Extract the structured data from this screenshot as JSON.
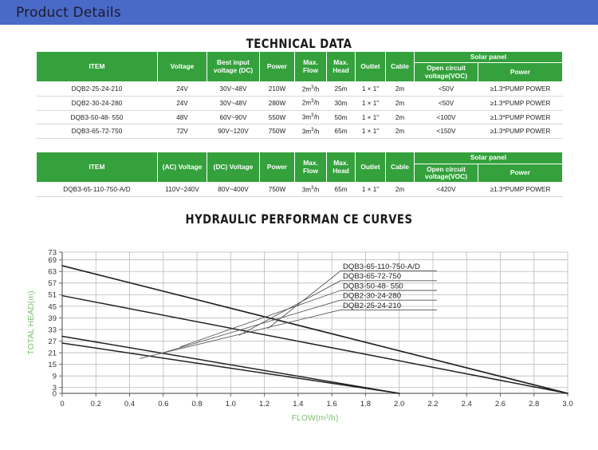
{
  "header": {
    "title": "Product Details"
  },
  "tech_section": {
    "title": "TECHNICAL DATA"
  },
  "table1": {
    "headers": {
      "item": "ITEM",
      "voltage": "Voltage",
      "best_input_voltage": "Best input voltage (DC)",
      "power": "Power",
      "max_flow": "Max. Flow",
      "max_head": "Max. Head",
      "outlet": "Outlet",
      "cable": "Cable",
      "solar_panel": "Solar panel",
      "open_circuit_voltage": "Open circuit voltage(VOC)",
      "solar_power": "Power"
    },
    "rows": [
      {
        "item": "DQB2-25-24-210",
        "voltage": "24V",
        "best_input_voltage": "30V~48V",
        "power": "210W",
        "max_flow": "2m3/h",
        "max_flow_num": "2m",
        "max_flow_sup": "3",
        "max_flow_tail": "/h",
        "max_head": "25m",
        "outlet": "1 × 1\"",
        "cable": "2m",
        "voc": "<50V",
        "solar_power": "≥1.3*PUMP POWER"
      },
      {
        "item": "DQB2-30-24-280",
        "voltage": "24V",
        "best_input_voltage": "30V~48V",
        "power": "280W",
        "max_flow_num": "2m",
        "max_flow_sup": "3",
        "max_flow_tail": "/h",
        "max_head": "30m",
        "outlet": "1 × 1\"",
        "cable": "2m",
        "voc": "<50V",
        "solar_power": "≥1.3*PUMP POWER"
      },
      {
        "item": "DQB3-50-48- 550",
        "voltage": "48V",
        "best_input_voltage": "60V~90V",
        "power": "550W",
        "max_flow_num": "3m",
        "max_flow_sup": "3",
        "max_flow_tail": "/h",
        "max_head": "50m",
        "outlet": "1 × 1\"",
        "cable": "2m",
        "voc": "<100V",
        "solar_power": "≥1.3*PUMP POWER"
      },
      {
        "item": "DQB3-65-72-750",
        "voltage": "72V",
        "best_input_voltage": "90V~120V",
        "power": "750W",
        "max_flow_num": "3m",
        "max_flow_sup": "3",
        "max_flow_tail": "/h",
        "max_head": "65m",
        "outlet": "1 × 1\"",
        "cable": "2m",
        "voc": "<150V",
        "solar_power": "≥1.3*PUMP POWER"
      }
    ]
  },
  "table2": {
    "headers": {
      "item": "ITEM",
      "ac_voltage": "(AC) Voltage",
      "dc_voltage": "(DC) Voltage",
      "power": "Power",
      "max_flow": "Max. Flow",
      "max_head": "Max. Head",
      "outlet": "Outlet",
      "cable": "Cable",
      "solar_panel": "Solar panel",
      "open_circuit_voltage": "Open circuit voltage(VOC)",
      "solar_power": "Power"
    },
    "rows": [
      {
        "item": "DQB3-65-110-750-A/D",
        "ac_voltage": "110V~240V",
        "dc_voltage": "80V~400V",
        "power": "750W",
        "max_flow_num": "3m",
        "max_flow_sup": "3",
        "max_flow_tail": "/h",
        "max_head": "65m",
        "outlet": "1 × 1\"",
        "cable": "2m",
        "voc": "<420V",
        "solar_power": "≥1.3*PUMP POWER"
      }
    ]
  },
  "chart_data": {
    "type": "line",
    "title": "HYDRAULIC PERFORMAN CE CURVES",
    "xlabel": "FLOW(m3/h)",
    "xlabel_parts": {
      "pre": "FLOW(m",
      "sup": "3",
      "post": "/h)"
    },
    "ylabel": "TOTAL HEAD(m)",
    "xlim": [
      0,
      3.0
    ],
    "ylim": [
      0,
      73
    ],
    "xticks": [
      "0",
      "0.2",
      "0.4",
      "0.6",
      "0.8",
      "1.0",
      "1.2",
      "1.4",
      "1.6",
      "1.8",
      "2.0",
      "2.2",
      "2.4",
      "2.6",
      "2.8",
      "3.0"
    ],
    "xtick_values": [
      0,
      0.2,
      0.4,
      0.6,
      0.8,
      1.0,
      1.2,
      1.4,
      1.6,
      1.8,
      2.0,
      2.2,
      2.4,
      2.6,
      2.8,
      3.0
    ],
    "yticks": [
      "0",
      "3",
      "9",
      "15",
      "21",
      "27",
      "33",
      "39",
      "45",
      "51",
      "57",
      "63",
      "69",
      "73"
    ],
    "ytick_values": [
      0,
      3,
      9,
      15,
      21,
      27,
      33,
      39,
      45,
      51,
      57,
      63,
      69,
      73
    ],
    "grid": true,
    "legend_position": "inside-upper-right",
    "axis_label_color": "#7fbf72",
    "tick_label_color": "#333333",
    "curve_color": "#222222",
    "series": [
      {
        "name": "DQB3-65-110-750-A/D",
        "points": [
          [
            0,
            66
          ],
          [
            3.0,
            0
          ]
        ],
        "leader_anchor": [
          1.22,
          33.5
        ]
      },
      {
        "name": "DQB3-65-72-750",
        "points": [
          [
            0,
            66
          ],
          [
            3.0,
            0
          ]
        ],
        "leader_anchor": [
          1.05,
          30.0
        ]
      },
      {
        "name": "DQB3-50-48- 550",
        "points": [
          [
            0,
            50.5
          ],
          [
            3.0,
            0
          ]
        ],
        "leader_anchor": [
          0.7,
          24.0
        ]
      },
      {
        "name": "DQB2-30-24-280",
        "points": [
          [
            0,
            29.5
          ],
          [
            2.0,
            0
          ]
        ],
        "leader_anchor": [
          0.58,
          20.5
        ]
      },
      {
        "name": "DQB2-25-24-210",
        "points": [
          [
            0,
            26.0
          ],
          [
            2.0,
            0
          ]
        ],
        "leader_anchor": [
          0.46,
          18.0
        ]
      }
    ]
  }
}
